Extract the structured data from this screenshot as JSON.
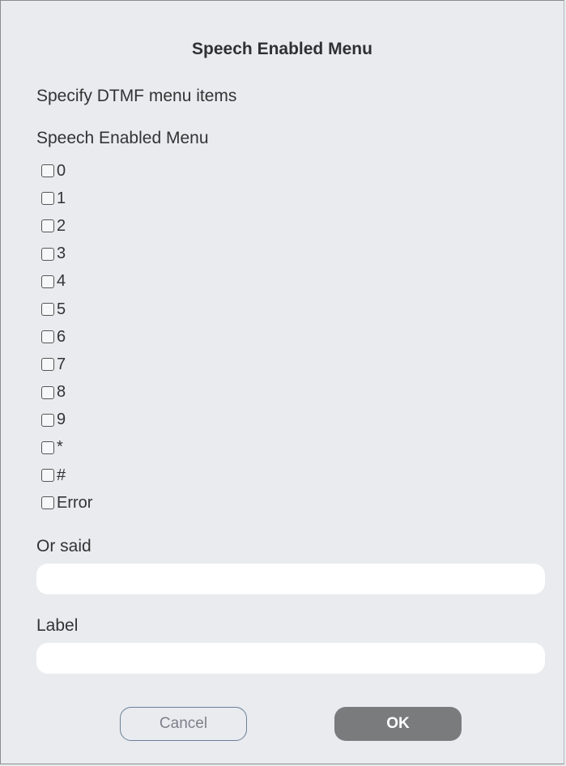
{
  "dialog": {
    "title": "Speech Enabled Menu",
    "subtitle": "Specify DTMF menu items",
    "group_label": "Speech Enabled Menu",
    "options": [
      {
        "label": "0",
        "checked": false
      },
      {
        "label": "1",
        "checked": false
      },
      {
        "label": "2",
        "checked": false
      },
      {
        "label": "3",
        "checked": false
      },
      {
        "label": "4",
        "checked": false
      },
      {
        "label": "5",
        "checked": false
      },
      {
        "label": "6",
        "checked": false
      },
      {
        "label": "7",
        "checked": false
      },
      {
        "label": "8",
        "checked": false
      },
      {
        "label": "9",
        "checked": false
      },
      {
        "label": "*",
        "checked": false
      },
      {
        "label": "#",
        "checked": false
      },
      {
        "label": "Error",
        "checked": false
      }
    ],
    "or_said": {
      "label": "Or said",
      "value": ""
    },
    "label_field": {
      "label": "Label",
      "value": ""
    },
    "buttons": {
      "cancel": "Cancel",
      "ok": "OK"
    }
  },
  "colors": {
    "background": "#e9ebef",
    "ok_button": "#7a7b7d",
    "cancel_border": "#6b7f98"
  }
}
